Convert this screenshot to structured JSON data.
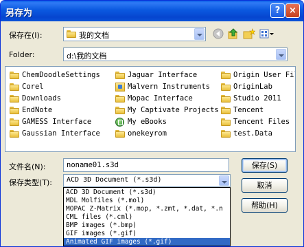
{
  "window": {
    "title": "另存为",
    "help_glyph": "?",
    "close_glyph": "×"
  },
  "save_in": {
    "label": "保存在(I):",
    "value": "我的文档"
  },
  "folder_row": {
    "label": "Folder:",
    "value": "d:\\我的文档"
  },
  "toolbar": {
    "back_icon": "back-arrow-icon",
    "up_icon": "up-folder-icon",
    "new_icon": "new-folder-icon",
    "view_icon": "view-menu-icon"
  },
  "files": [
    {
      "name": "ChemDoodleSettings",
      "icon": "folder-icon"
    },
    {
      "name": "Corel",
      "icon": "folder-icon"
    },
    {
      "name": "Downloads",
      "icon": "folder-icon"
    },
    {
      "name": "EndNote",
      "icon": "folder-icon"
    },
    {
      "name": "GAMESS Interface",
      "icon": "folder-icon"
    },
    {
      "name": "Gaussian Interface",
      "icon": "folder-icon"
    },
    {
      "name": "Jaguar Interface",
      "icon": "folder-icon"
    },
    {
      "name": "Malvern Instruments",
      "icon": "special-folder-icon"
    },
    {
      "name": "Mopac Interface",
      "icon": "folder-icon"
    },
    {
      "name": "My Captivate Projects",
      "icon": "folder-icon"
    },
    {
      "name": "My eBooks",
      "icon": "ebook-icon"
    },
    {
      "name": "onekeyrom",
      "icon": "folder-icon"
    },
    {
      "name": "Origin User Fil",
      "icon": "folder-icon"
    },
    {
      "name": "OriginLab",
      "icon": "folder-icon"
    },
    {
      "name": "Studio 2011",
      "icon": "folder-icon"
    },
    {
      "name": "Tencent",
      "icon": "folder-icon"
    },
    {
      "name": "Tencent Files",
      "icon": "folder-icon"
    },
    {
      "name": "test.Data",
      "icon": "folder-icon"
    }
  ],
  "filename": {
    "label": "文件名(N):",
    "value": "noname01.s3d"
  },
  "filetype": {
    "label": "保存类型(T):",
    "value": "ACD 3D Document (*.s3d)",
    "options": [
      "ACD 3D Document (*.s3d)",
      "MDL Molfiles (*.mol)",
      "MOPAC Z-Matrix (*.mop, *.zmt, *.dat, *.n",
      "CML files (*.cml)",
      "BMP images (*.bmp)",
      "GIF images (*.gif)",
      "Animated GIF images (*.gif)"
    ],
    "highlighted": "Animated GIF images (*.gif)"
  },
  "buttons": {
    "save": "保存(S)",
    "cancel": "取消",
    "help": "帮助(H)"
  },
  "colors": {
    "titlebar": "#0a5fe8",
    "dialog_bg": "#ece9d8",
    "selection": "#316ac5"
  }
}
